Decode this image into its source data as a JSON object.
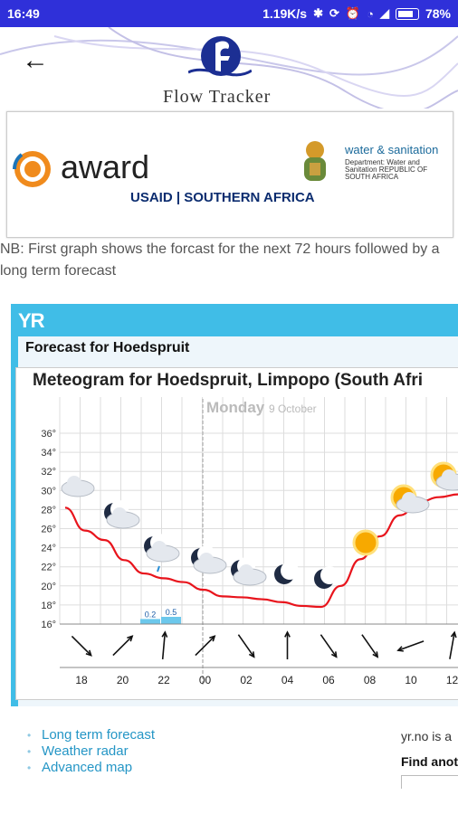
{
  "status": {
    "time": "16:49",
    "speed": "1.19K/s",
    "battery": "78%"
  },
  "app": {
    "brand": "Flow Tracker"
  },
  "logos": {
    "award": "award",
    "usaid": "USAID | SOUTHERN AFRICA",
    "water": "water & sanitation",
    "dept": "Department: Water and Sanitation REPUBLIC OF SOUTH AFRICA"
  },
  "note": "NB: First graph shows the forcast for the next 72 hours followed by a long term forecast",
  "yr": {
    "logo": "YR",
    "forecast_title": "Forecast for Hoedspruit",
    "meteogram_title": "Meteogram for Hoedspruit, Limpopo (South Afri",
    "day_label": "Monday",
    "day_date": "9 October",
    "links": [
      "Long term forecast",
      "Weather radar",
      "Advanced map"
    ],
    "yrno_text": "yr.no is a",
    "find_text": "Find anot"
  },
  "chart_data": {
    "type": "line",
    "ylim": [
      16,
      36
    ],
    "yticks": [
      "36°",
      "34°",
      "32°",
      "30°",
      "28°",
      "26°",
      "24°",
      "22°",
      "20°",
      "18°",
      "16°"
    ],
    "x_labels": [
      "18",
      "20",
      "22",
      "00",
      "02",
      "04",
      "06",
      "08",
      "10",
      "12"
    ],
    "series": [
      {
        "color": "#e8141c",
        "x": [
          17,
          18,
          19,
          20,
          21,
          22,
          23,
          0,
          1,
          2,
          3,
          4,
          5,
          6,
          7,
          8,
          9,
          10,
          11,
          12,
          13
        ],
        "values": [
          28.2,
          25.8,
          24.8,
          22.7,
          21.3,
          20.8,
          20.4,
          19.6,
          18.9,
          18.8,
          18.6,
          18.3,
          17.9,
          17.8,
          20,
          22.8,
          25.2,
          27.4,
          28.8,
          29.3,
          29.6
        ]
      }
    ],
    "precipitation": [
      {
        "x": 22,
        "value": 0.2
      },
      {
        "x": 23,
        "value": 0.5
      }
    ],
    "precip_labels": [
      "0.2",
      "0.5"
    ],
    "wind_arrows_deg": [
      135,
      45,
      5,
      45,
      145,
      0,
      145,
      145,
      250,
      10
    ]
  }
}
